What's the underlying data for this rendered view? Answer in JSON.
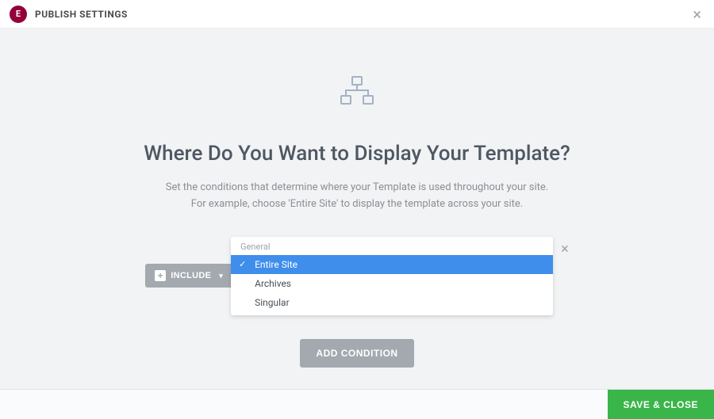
{
  "header": {
    "logo_text": "E",
    "title": "PUBLISH SETTINGS"
  },
  "body": {
    "heading": "Where Do You Want to Display Your Template?",
    "description_line1": "Set the conditions that determine where your Template is used throughout your site.",
    "description_line2": "For example, choose 'Entire Site' to display the template across your site.",
    "include": {
      "label": "INCLUDE"
    },
    "dropdown": {
      "group_label": "General",
      "options": [
        {
          "label": "Entire Site",
          "selected": true
        },
        {
          "label": "Archives",
          "selected": false
        },
        {
          "label": "Singular",
          "selected": false
        }
      ]
    },
    "add_condition_label": "ADD CONDITION"
  },
  "footer": {
    "save_label": "SAVE & CLOSE"
  }
}
